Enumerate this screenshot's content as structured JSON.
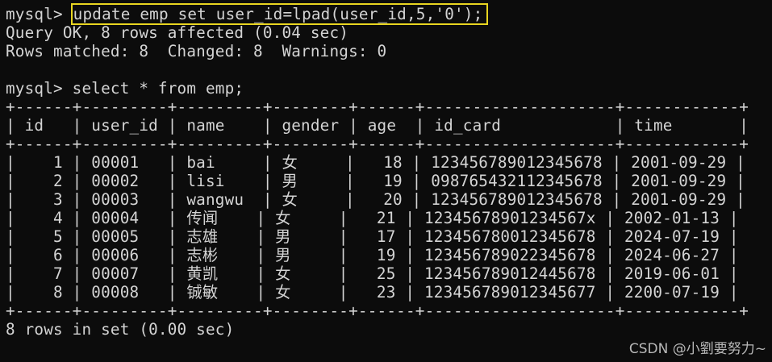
{
  "lines": {
    "l0_prompt": "mysql> ",
    "l0_command": "update emp set user_id=lpad(user_id,5,'0');",
    "l1": "Query OK, 8 rows affected (0.04 sec)",
    "l2": "Rows matched: 8  Changed: 8  Warnings: 0",
    "l4": "mysql> select * from emp;",
    "sep": "+------+---------+---------+--------+------+--------------------+------------+",
    "header": "| id   | user_id | name    | gender | age  | id_card            | time       |",
    "rows": [
      "|    1 | 00001   | bai     | 女     |   18 | 12345678901234567​8 | 2001-09-29 |",
      "|    2 | 00002   | lisi    | 男     |   19 | 098765432112345678 | 2001-09-29 |",
      "|    3 | 00003   | wangwu  | 女     |   20 | 123456789012345678 | 2001-09-29 |",
      "|    4 | 00004   | 传闻    | 女     |   21 | 12345678901234567x | 2002-01-13 |",
      "|    5 | 00005   | 志雄    | 男     |   17 | 123456780012345678 | 2024-07-19 |",
      "|    6 | 00006   | 志彬    | 男     |   19 | 123456789022345678 | 2024-06-27 |",
      "|    7 | 00007   | 黄凯    | 女     |   25 | 123456789012445678 | 2019-06-01 |",
      "|    8 | 00008   | 铖敏    | 女     |   23 | 123456789012345677 | 2200-07-19 |"
    ],
    "footer": "8 rows in set (0.00 sec)"
  },
  "watermark": "CSDN @小劉要努力~"
}
